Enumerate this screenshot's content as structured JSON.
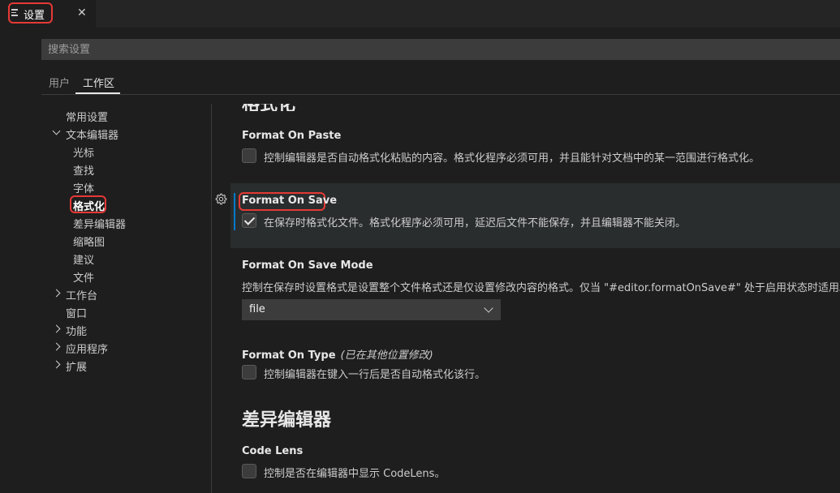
{
  "tab": {
    "title": "设置",
    "close_glyph": "✕",
    "icon": "settings-list-icon"
  },
  "search": {
    "placeholder": "搜索设置",
    "value": ""
  },
  "scope_tabs": [
    {
      "label": "用户",
      "active": false
    },
    {
      "label": "工作区",
      "active": true
    }
  ],
  "toc": [
    {
      "label": "常用设置",
      "expandable": false
    },
    {
      "label": "文本编辑器",
      "expandable": true,
      "expanded": true,
      "children": [
        "光标",
        "查找",
        "字体",
        "格式化",
        "差异编辑器",
        "缩略图",
        "建议",
        "文件"
      ]
    },
    {
      "label": "工作台",
      "expandable": true,
      "expanded": false
    },
    {
      "label": "窗口",
      "expandable": false
    },
    {
      "label": "功能",
      "expandable": true,
      "expanded": false
    },
    {
      "label": "应用程序",
      "expandable": true,
      "expanded": false
    },
    {
      "label": "扩展",
      "expandable": true,
      "expanded": false
    }
  ],
  "toc_active": "格式化",
  "content": {
    "section_heading_partial": "格式化",
    "settings": [
      {
        "title": "Format On Paste",
        "checked": false,
        "description": "控制编辑器是否自动格式化粘贴的内容。格式化程序必须可用，并且能针对文档中的某一范围进行格式化。"
      },
      {
        "title": "Format On Save",
        "checked": true,
        "focused": true,
        "description": "在保存时格式化文件。格式化程序必须可用，延迟后文件不能保存，并且编辑器不能关闭。"
      },
      {
        "title": "Format On Save Mode",
        "description": "控制在保存时设置格式是设置整个文件格式还是仅设置修改内容的格式。仅当 \"#editor.formatOnSave#\" 处于启用状态时适用。",
        "select_value": "file"
      },
      {
        "title": "Format On Type",
        "modified_note": "(已在其他位置修改)",
        "checked": false,
        "description": "控制编辑器在键入一行后是否自动格式化该行。"
      }
    ],
    "section2_heading": "差异编辑器",
    "section2_settings": [
      {
        "title": "Code Lens",
        "checked": false,
        "description": "控制是否在编辑器中显示 CodeLens。"
      }
    ]
  },
  "colors": {
    "background": "#1e1e1e",
    "focus_accent": "#007acc",
    "highlight_annotation": "#e53935"
  }
}
